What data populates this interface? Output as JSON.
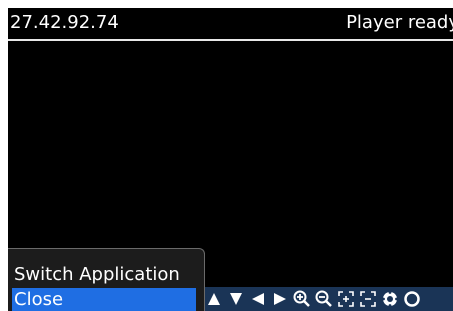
{
  "status_bar": {
    "left_text": "27.42.92.74",
    "right_text": "Player ready"
  },
  "menu": {
    "items": [
      {
        "label": "Switch Application"
      },
      {
        "label": "Close",
        "selected": true
      }
    ]
  },
  "toolbar": {
    "icons": [
      "scroll-up-icon",
      "scroll-down-icon",
      "scroll-left-icon",
      "scroll-right-icon",
      "zoom-in-icon",
      "zoom-out-icon",
      "fit-screen-icon",
      "actual-size-icon",
      "rotate-icon",
      "settings-icon"
    ]
  },
  "colors": {
    "screen_background": "#000000",
    "toolbar_background": "#1a3456",
    "menu_background": "#1c1c1c",
    "menu_selected": "#1f6ee3",
    "text": "#ffffff"
  }
}
